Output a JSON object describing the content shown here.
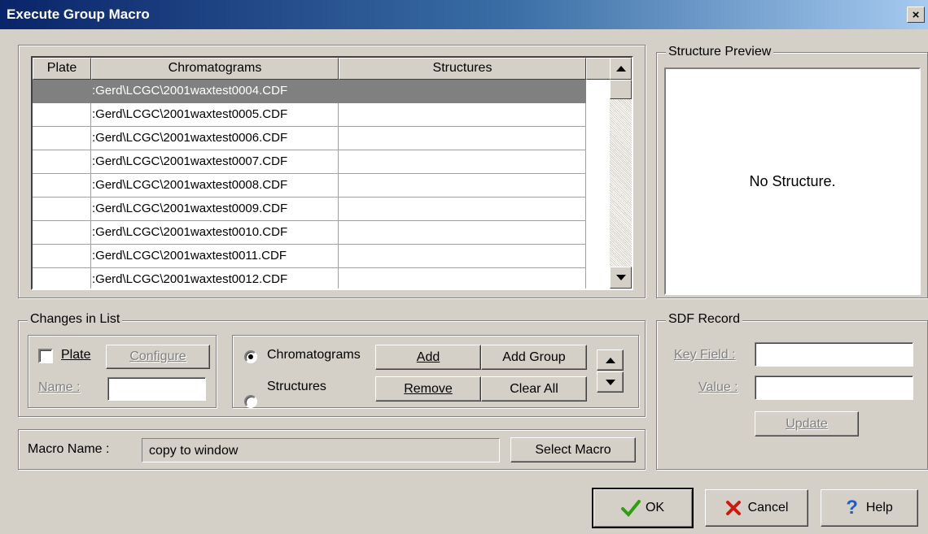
{
  "window": {
    "title": "Execute Group Macro",
    "close": "×"
  },
  "grid": {
    "columns": [
      "Plate",
      "Chromatograms",
      "Structures"
    ],
    "rows": [
      {
        "plate": "",
        "chrom": ":Gerd\\LCGC\\2001waxtest0004.CDF",
        "struct": "",
        "selected": true
      },
      {
        "plate": "",
        "chrom": ":Gerd\\LCGC\\2001waxtest0005.CDF",
        "struct": ""
      },
      {
        "plate": "",
        "chrom": ":Gerd\\LCGC\\2001waxtest0006.CDF",
        "struct": ""
      },
      {
        "plate": "",
        "chrom": ":Gerd\\LCGC\\2001waxtest0007.CDF",
        "struct": ""
      },
      {
        "plate": "",
        "chrom": ":Gerd\\LCGC\\2001waxtest0008.CDF",
        "struct": ""
      },
      {
        "plate": "",
        "chrom": ":Gerd\\LCGC\\2001waxtest0009.CDF",
        "struct": ""
      },
      {
        "plate": "",
        "chrom": ":Gerd\\LCGC\\2001waxtest0010.CDF",
        "struct": ""
      },
      {
        "plate": "",
        "chrom": ":Gerd\\LCGC\\2001waxtest0011.CDF",
        "struct": ""
      },
      {
        "plate": "",
        "chrom": ":Gerd\\LCGC\\2001waxtest0012.CDF",
        "struct": ""
      }
    ]
  },
  "preview": {
    "legend": "Structure Preview",
    "empty_text": "No Structure."
  },
  "changes": {
    "legend": "Changes in List",
    "plate_label": "Plate",
    "configure": "Configure",
    "name_label": "Name :",
    "name_value": "",
    "radio_chrom": "Chromatograms",
    "radio_struct": "Structures",
    "selected_radio": "Chromatograms",
    "add": "Add",
    "add_group": "Add Group",
    "remove": "Remove",
    "clear_all": "Clear All"
  },
  "macro": {
    "label": "Macro Name :",
    "value": "copy to window",
    "select": "Select Macro"
  },
  "sdf": {
    "legend": "SDF Record",
    "key_label": "Key Field :",
    "key_value": "",
    "value_label": "Value :",
    "value_value": "",
    "update": "Update"
  },
  "buttons": {
    "ok": "OK",
    "cancel": "Cancel",
    "help": "Help"
  },
  "colors": {
    "ok_check": "#2f9e0f",
    "cancel_x": "#cc1a10",
    "help_q": "#1a5fc8",
    "selection": "#808080"
  }
}
